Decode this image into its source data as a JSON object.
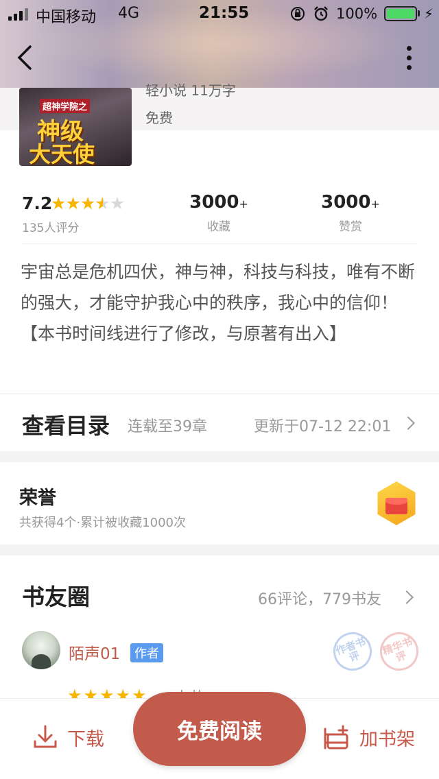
{
  "status_bar": {
    "carrier": "中国移动",
    "network": "4G",
    "time": "21:55",
    "battery": "100%"
  },
  "book": {
    "cover_subtitle": "超神学院之",
    "cover_title_line1": "神级",
    "cover_title_line2": "大天使",
    "meta": "轻小说 11万字",
    "price": "免费"
  },
  "stats": {
    "rating": "7.2",
    "rating_stars": 3.5,
    "rating_count": "135人评分",
    "favorites_value": "3000",
    "favorites_suffix": "+",
    "favorites_label": "收藏",
    "rewards_value": "3000",
    "rewards_suffix": "+",
    "rewards_label": "赞赏"
  },
  "description": "宇宙总是危机四伏，神与神，科技与科技，唯有不断的强大，才能守护我心中的秩序，我心中的信仰！【本书时间线进行了修改，与原著有出入】",
  "toc": {
    "title": "查看目录",
    "serial": "连载至39章",
    "updated": "更新于07-12 22:01"
  },
  "honor": {
    "title": "荣誉",
    "subtitle": "共获得4个·累计被收藏1000次",
    "badge_icon": "red-envelope-icon"
  },
  "circle": {
    "title": "书友圈",
    "stats": "66评论，779书友",
    "user_name": "陌声01",
    "author_tag": "作者",
    "stamp_author": "作者书评",
    "stamp_featured": "精华书评",
    "peek_stars": "★★★★★",
    "peek_text": "大苗"
  },
  "bottom_bar": {
    "download_label": "下载",
    "read_label": "免费阅读",
    "shelf_label": "加书架"
  },
  "colors": {
    "accent": "#c25b4b",
    "star": "#f7b500",
    "tag_blue": "#5b9bef"
  }
}
